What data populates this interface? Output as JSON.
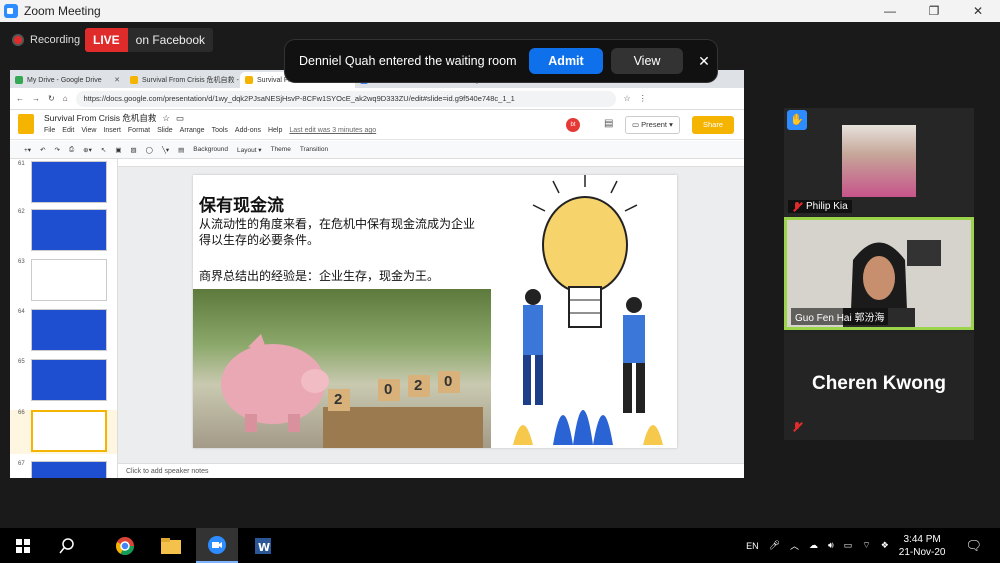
{
  "window": {
    "title": "Zoom Meeting",
    "minimize": "—",
    "restore": "❐",
    "close": "✕"
  },
  "recording": {
    "label": "Recording"
  },
  "live": {
    "badge": "LIVE",
    "target": "on Facebook"
  },
  "notification": {
    "message": "Denniel Quah entered the waiting room",
    "admit": "Admit",
    "view": "View",
    "close": "✕"
  },
  "browser": {
    "tabs": [
      {
        "label": "My Drive - Google Drive",
        "color": "#34a853"
      },
      {
        "label": "Survival From Crisis 危机自救 -",
        "color": "#f4b400"
      },
      {
        "label": "Survival From Crisis 危机自救",
        "color": "#f4b400"
      },
      {
        "label": "",
        "color": "#4285f4"
      }
    ],
    "url": "https://docs.google.com/presentation/d/1wy_dqk2PJsaNESjHsvP-8CFw1SYOcE_ak2wq9D333ZU/edit#slide=id.g9f540e748c_1_1"
  },
  "slides_app": {
    "title": "Survival From Crisis 危机自救",
    "menus": [
      "File",
      "Edit",
      "View",
      "Insert",
      "Format",
      "Slide",
      "Arrange",
      "Tools",
      "Add-ons",
      "Help"
    ],
    "last_edit": "Last edit was 3 minutes ago",
    "present": "Present",
    "share": "Share",
    "avatar": "bt",
    "toolbar": [
      "Background",
      "Layout ▾",
      "Theme",
      "Transition"
    ],
    "thumbnails": [
      {
        "num": "61",
        "color": "#1e4fd1",
        "selected": false
      },
      {
        "num": "62",
        "color": "#1e4fd1",
        "selected": false
      },
      {
        "num": "63",
        "color": "#ffffff",
        "selected": false
      },
      {
        "num": "64",
        "color": "#1e4fd1",
        "selected": false
      },
      {
        "num": "65",
        "color": "#1e4fd1",
        "selected": false
      },
      {
        "num": "66",
        "color": "#ffffff",
        "selected": true
      },
      {
        "num": "67",
        "color": "#1e4fd1",
        "selected": false
      }
    ],
    "speaker_notes": "Click to add speaker notes"
  },
  "slide": {
    "title": "保有现金流",
    "line1": "从流动性的角度来看，在危机中保有现金流成为企业",
    "line2": "得以生存的必要条件。",
    "line3": "商界总结出的经验是：企业生存，现金为王。",
    "year_digits": [
      "2",
      "0",
      "2",
      "0"
    ]
  },
  "participants": [
    {
      "name": "Philip Kia",
      "muted": true
    },
    {
      "name": "Guo Fen  Hai 郭汾海",
      "muted": false,
      "active_speaker": true
    },
    {
      "name": "Cheren Kwong",
      "muted": true
    }
  ],
  "taskbar": {
    "language": "EN",
    "time": "3:44 PM",
    "date": "21-Nov-20"
  }
}
